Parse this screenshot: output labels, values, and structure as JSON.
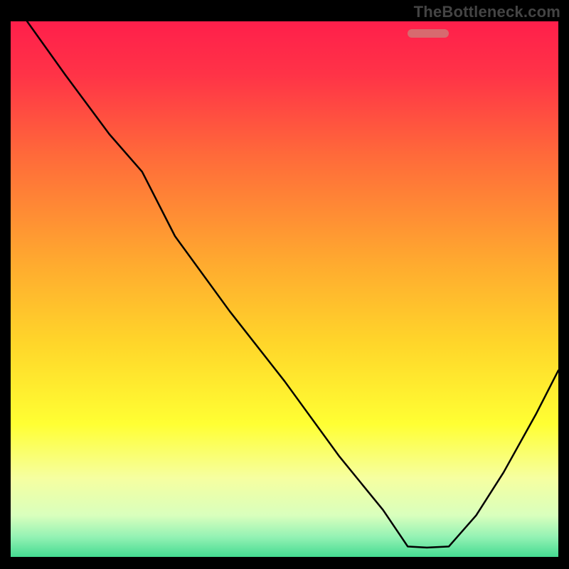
{
  "watermark": "TheBottleneck.com",
  "gradient": {
    "stops": [
      {
        "offset": 0.0,
        "color": "#ff1f4b"
      },
      {
        "offset": 0.1,
        "color": "#ff3347"
      },
      {
        "offset": 0.25,
        "color": "#ff6a3a"
      },
      {
        "offset": 0.45,
        "color": "#ffaa2f"
      },
      {
        "offset": 0.6,
        "color": "#ffd62a"
      },
      {
        "offset": 0.75,
        "color": "#ffff33"
      },
      {
        "offset": 0.85,
        "color": "#f6ffa0"
      },
      {
        "offset": 0.92,
        "color": "#d9ffbd"
      },
      {
        "offset": 0.96,
        "color": "#94f2b4"
      },
      {
        "offset": 1.0,
        "color": "#3fd98f"
      }
    ]
  },
  "curve_stroke": "#000000",
  "marker": {
    "color": "#d76a6f",
    "x_start": 0.725,
    "x_end": 0.8,
    "y": 0.978
  },
  "chart_data": {
    "type": "line",
    "title": "",
    "xlabel": "",
    "ylabel": "",
    "xlim": [
      0,
      1
    ],
    "ylim": [
      0,
      1
    ],
    "x": [
      0.03,
      0.1,
      0.18,
      0.24,
      0.3,
      0.4,
      0.5,
      0.6,
      0.68,
      0.725,
      0.76,
      0.8,
      0.85,
      0.9,
      0.96,
      1.0
    ],
    "y": [
      1.0,
      0.9,
      0.79,
      0.72,
      0.6,
      0.46,
      0.33,
      0.19,
      0.09,
      0.022,
      0.02,
      0.022,
      0.08,
      0.16,
      0.27,
      0.35
    ],
    "note": "x,y are fractional positions in the plot area (0..1). y measured from bottom. Curve descends from top-left, bends near x≈0.24, reaches a flat trough between x≈0.725–0.80 at y≈0.02, then rises toward the right edge."
  }
}
